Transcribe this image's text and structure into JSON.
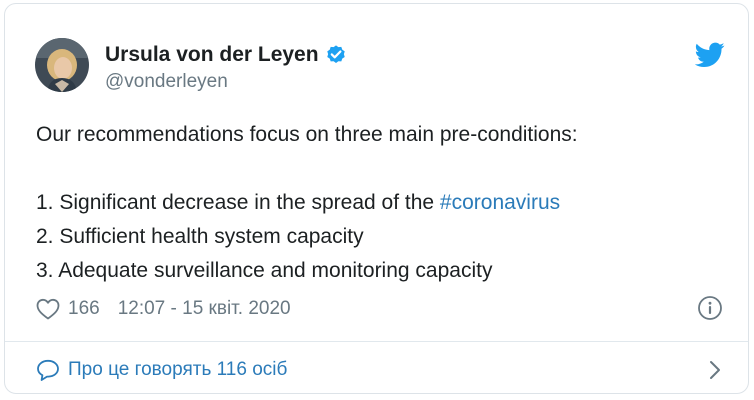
{
  "colors": {
    "link": "#2b7bb9",
    "verified": "#1da1f2",
    "twitter_brand": "#1da1f2",
    "muted": "#697882",
    "text": "#1c2022"
  },
  "author": {
    "display_name": "Ursula von der Leyen",
    "handle": "@vonderleyen",
    "verified_icon": "verified-badge-icon",
    "avatar": "avatar-photo"
  },
  "tweet": {
    "intro": "Our recommendations focus on three main pre-conditions:",
    "line1_prefix": "1. Significant decrease in the spread of the ",
    "line1_hashtag": "#coronavirus",
    "line2": "2. Sufficient health system capacity",
    "line3": "3. Adequate surveillance and monitoring capacity"
  },
  "meta": {
    "like_icon": "heart-icon",
    "like_count": "166",
    "timestamp": "12:07 - 15 квіт. 2020",
    "info_icon": "info-icon"
  },
  "footer": {
    "conversation_icon": "speech-bubble-icon",
    "conversation_label": "Про це говорять 116 осіб",
    "chevron_icon": "chevron-right-icon"
  },
  "brand_icon": "twitter-bird-icon"
}
